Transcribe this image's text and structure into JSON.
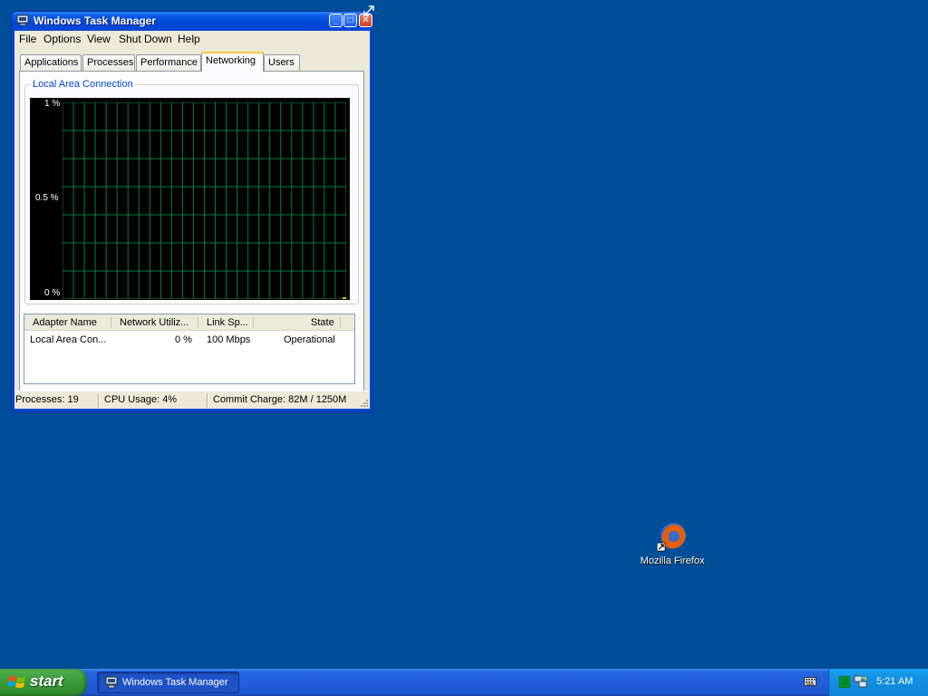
{
  "window": {
    "title": "Windows Task Manager",
    "min_label": "_",
    "max_label": "□",
    "close_label": "✕"
  },
  "menu": {
    "items": [
      "File",
      "Options",
      "View",
      "Shut Down",
      "Help"
    ]
  },
  "tabs": [
    {
      "label": "Applications",
      "active": false
    },
    {
      "label": "Processes",
      "active": false
    },
    {
      "label": "Performance",
      "active": false
    },
    {
      "label": "Networking",
      "active": true
    },
    {
      "label": "Users",
      "active": false
    }
  ],
  "graph": {
    "title": "Local Area Connection",
    "y_ticks": [
      "1 %",
      "0.5 %",
      "0 %"
    ],
    "grid_color": "#008040",
    "line_color": "#ffff00"
  },
  "adapters": {
    "columns": [
      "Adapter Name",
      "Network Utiliz...",
      "Link Sp...",
      "State"
    ],
    "rows": [
      {
        "name": "Local Area Con...",
        "utilization": "0 %",
        "link_speed": "100 Mbps",
        "state": "Operational"
      }
    ]
  },
  "status": {
    "processes": "Processes: 19",
    "cpu": "CPU Usage: 4%",
    "commit": "Commit Charge: 82M / 1250M"
  },
  "desktop": {
    "icons": [
      {
        "label": "Mozilla Firefox",
        "icon": "firefox-icon"
      }
    ],
    "background_color": "#004e98"
  },
  "taskbar": {
    "start_label": "start",
    "task_label": "Windows Task Manager",
    "clock": "5:21 AM"
  }
}
